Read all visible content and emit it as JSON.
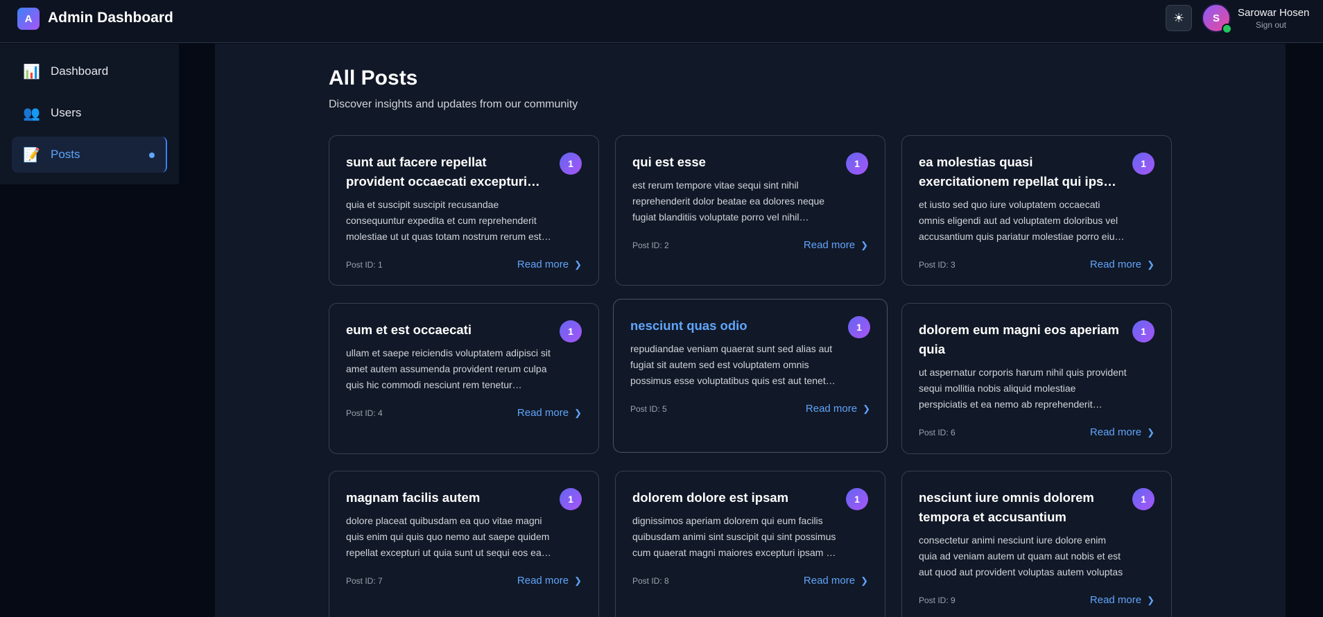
{
  "header": {
    "logo_letter": "A",
    "title": "Admin Dashboard",
    "theme_icon": "sun-icon",
    "user": {
      "initial": "S",
      "name": "Sarowar Hosen",
      "sign_out": "Sign out"
    }
  },
  "sidebar": {
    "items": [
      {
        "icon": "📊",
        "label": "Dashboard"
      },
      {
        "icon": "👥",
        "label": "Users"
      },
      {
        "icon": "📝",
        "label": "Posts",
        "active": true
      }
    ]
  },
  "main": {
    "title": "All Posts",
    "subtitle": "Discover insights and updates from our community"
  },
  "posts": [
    {
      "title": "sunt aut facere repellat provident occaecati excepturi optio reprehenderit",
      "body": "quia et suscipit suscipit recusandae consequuntur expedita et cum reprehenderit molestiae ut ut quas totam nostrum rerum est autem sunt rem eveniet architecto",
      "badge": "1",
      "post_id": "Post ID: 1",
      "read_more": "Read more"
    },
    {
      "title": "qui est esse",
      "body": "est rerum tempore vitae sequi sint nihil reprehenderit dolor beatae ea dolores neque fugiat blanditiis voluptate porro vel nihil molestiae ut reiciendis",
      "badge": "1",
      "post_id": "Post ID: 2",
      "read_more": "Read more"
    },
    {
      "title": "ea molestias quasi exercitationem repellat qui ipsa sit aut",
      "body": "et iusto sed quo iure voluptatem occaecati omnis eligendi aut ad voluptatem doloribus vel accusantium quis pariatur molestiae porro eius odio et labore et velit aut",
      "badge": "1",
      "post_id": "Post ID: 3",
      "read_more": "Read more"
    },
    {
      "title": "eum et est occaecati",
      "body": "ullam et saepe reiciendis voluptatem adipisci sit amet autem assumenda provident rerum culpa quis hic commodi nesciunt rem tenetur doloremque ipsam iure",
      "badge": "1",
      "post_id": "Post ID: 4",
      "read_more": "Read more"
    },
    {
      "title": "nesciunt quas odio",
      "body": "repudiandae veniam quaerat sunt sed alias aut fugiat sit autem sed est voluptatem omnis possimus esse voluptatibus quis est aut tenetur dolor neque",
      "badge": "1",
      "post_id": "Post ID: 5",
      "read_more": "Read more"
    },
    {
      "title": "dolorem eum magni eos aperiam quia",
      "body": "ut aspernatur corporis harum nihil quis provident sequi mollitia nobis aliquid molestiae perspiciatis et ea nemo ab reprehenderit accusantium quas voluptate dolores",
      "badge": "1",
      "post_id": "Post ID: 6",
      "read_more": "Read more"
    },
    {
      "title": "magnam facilis autem",
      "body": "dolore placeat quibusdam ea quo vitae magni quis enim qui quis quo nemo aut saepe quidem repellat excepturi ut quia sunt ut sequi eos ea sed quas",
      "badge": "1",
      "post_id": "Post ID: 7",
      "read_more": "Read more"
    },
    {
      "title": "dolorem dolore est ipsam",
      "body": "dignissimos aperiam dolorem qui eum facilis quibusdam animi sint suscipit qui sint possimus cum quaerat magni maiores excepturi ipsam ut commodi dolor voluptatum",
      "badge": "1",
      "post_id": "Post ID: 8",
      "read_more": "Read more"
    },
    {
      "title": "nesciunt iure omnis dolorem tempora et accusantium",
      "body": "consectetur animi nesciunt iure dolore enim quia ad veniam autem ut quam aut nobis et est aut quod aut provident voluptas autem voluptas",
      "badge": "1",
      "post_id": "Post ID: 9",
      "read_more": "Read more"
    }
  ],
  "colors": {
    "accent": "#60a5fa",
    "online": "#22c55e",
    "badge_from": "#6366f1",
    "badge_to": "#a855f7"
  }
}
